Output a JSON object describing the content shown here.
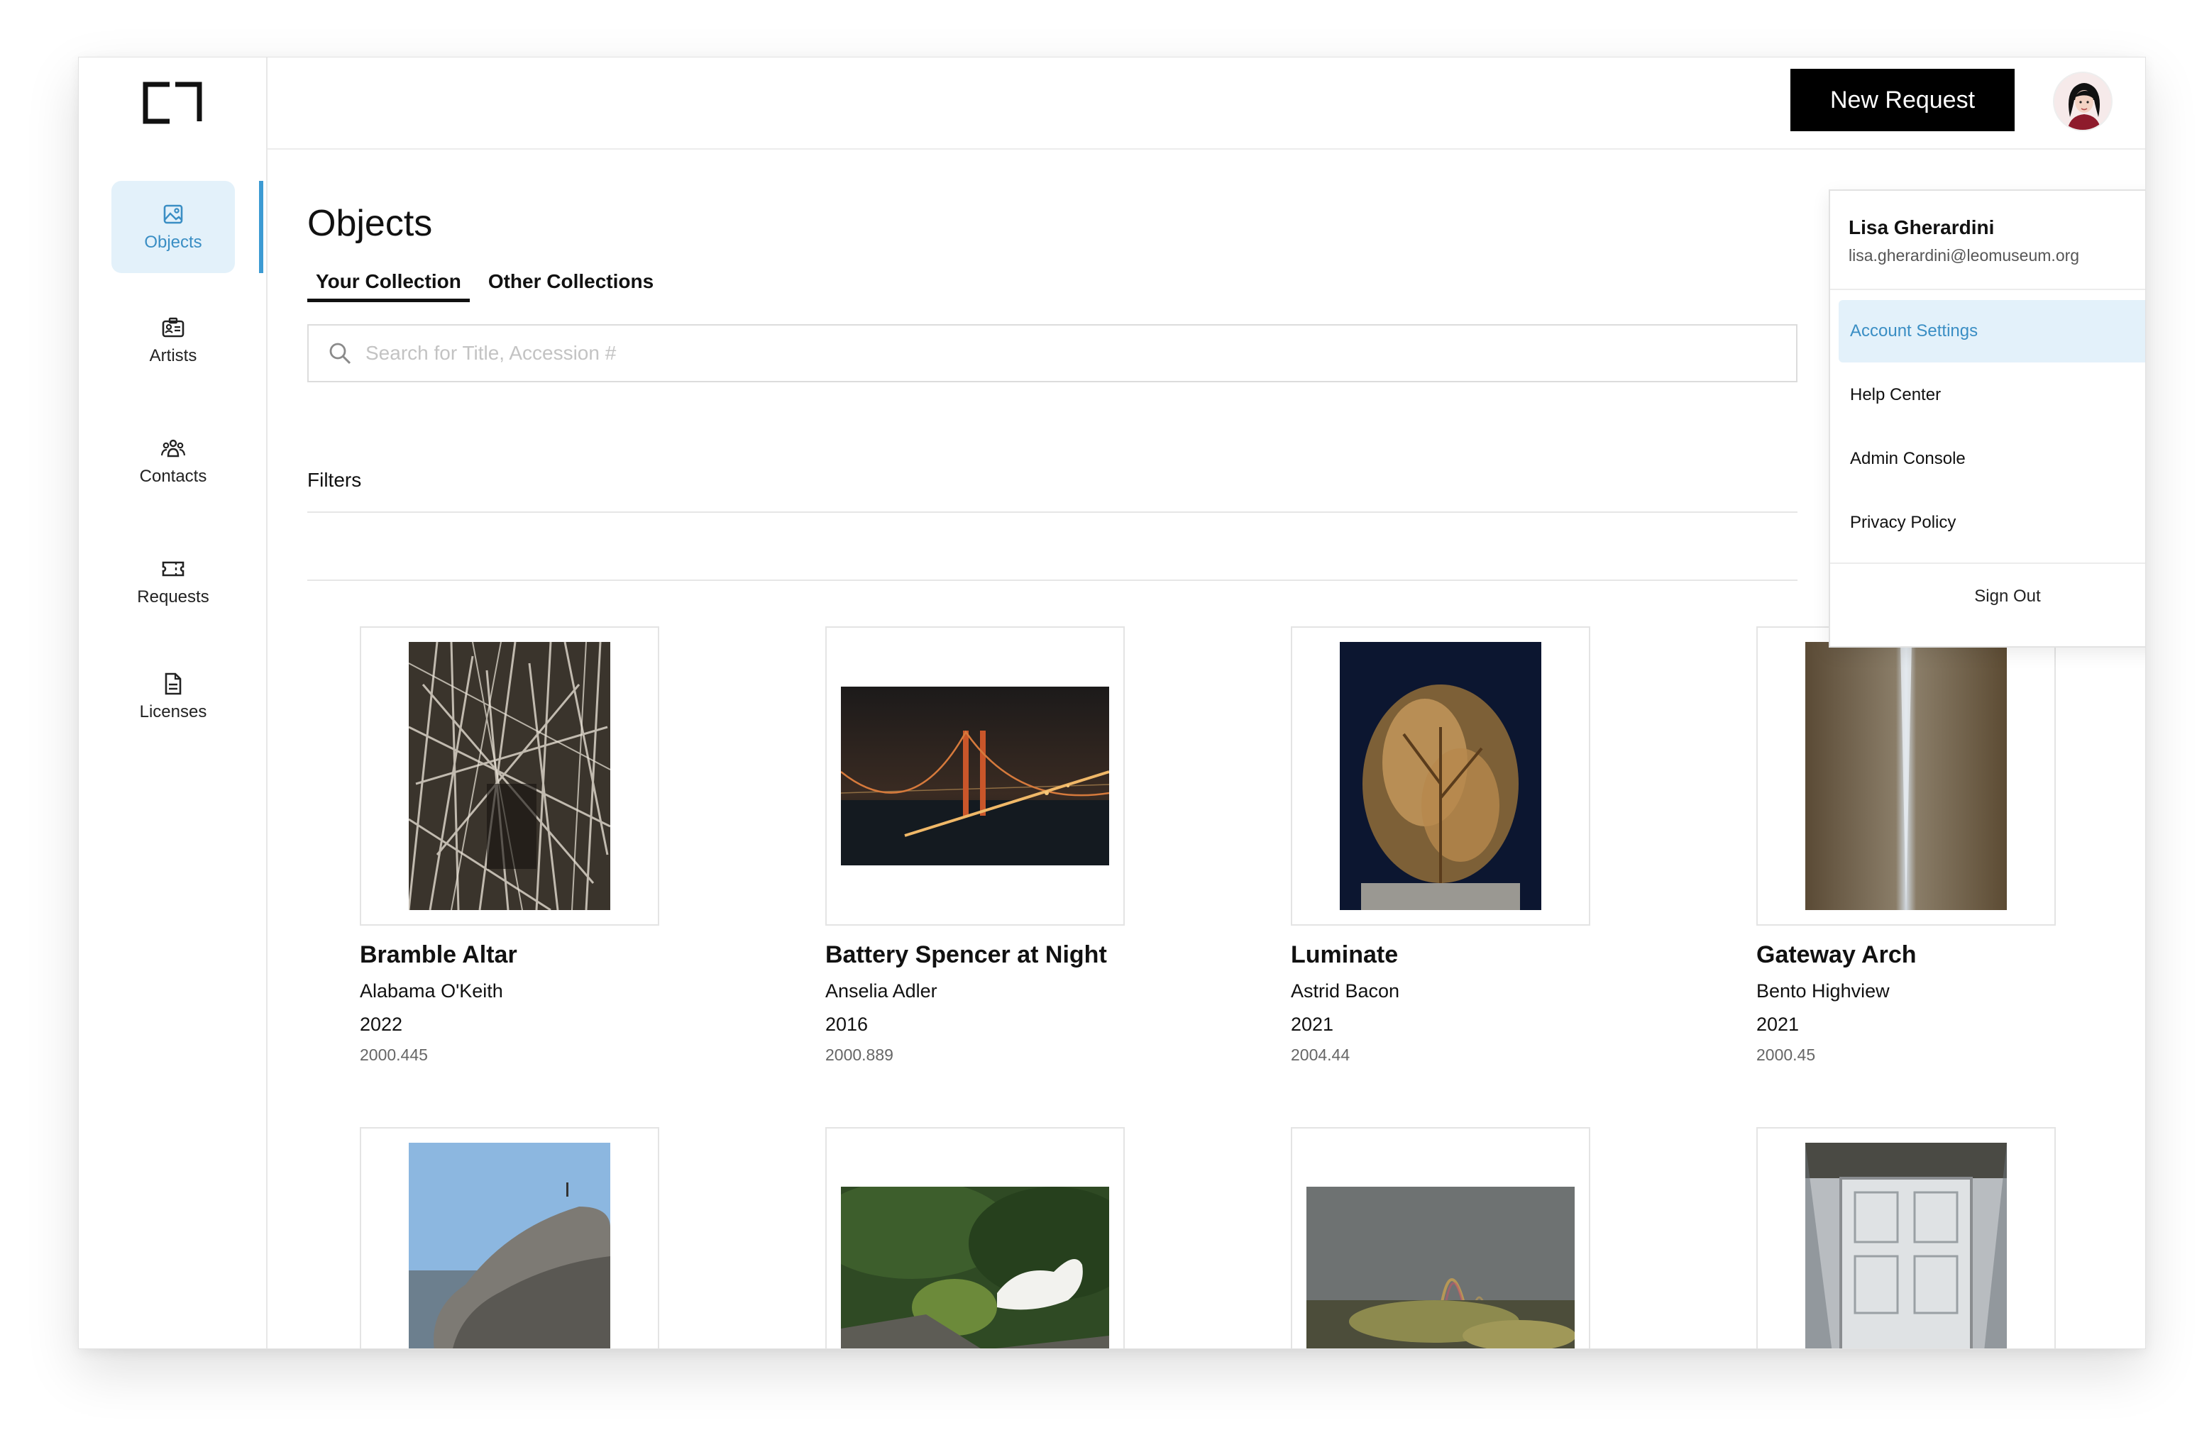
{
  "header": {
    "new_request_label": "New Request"
  },
  "sidebar": {
    "items": [
      {
        "label": "Objects",
        "icon": "image-icon"
      },
      {
        "label": "Artists",
        "icon": "id-card-icon"
      },
      {
        "label": "Contacts",
        "icon": "people-icon"
      },
      {
        "label": "Requests",
        "icon": "ticket-icon"
      },
      {
        "label": "Licenses",
        "icon": "document-icon"
      }
    ]
  },
  "main": {
    "title": "Objects",
    "tabs": [
      {
        "label": "Your Collection",
        "active": true
      },
      {
        "label": "Other Collections",
        "active": false
      }
    ],
    "search": {
      "placeholder": "Search for Title, Accession #",
      "value": ""
    },
    "filters_label": "Filters"
  },
  "objects": [
    {
      "title": "Bramble Altar",
      "artist": "Alabama O'Keith",
      "year": "2022",
      "accession": "2000.445"
    },
    {
      "title": "Battery Spencer at Night",
      "artist": "Anselia Adler",
      "year": "2016",
      "accession": "2000.889"
    },
    {
      "title": "Luminate",
      "artist": "Astrid Bacon",
      "year": "2021",
      "accession": "2004.44"
    },
    {
      "title": "Gateway Arch",
      "artist": "Bento Highview",
      "year": "2021",
      "accession": "2000.45"
    }
  ],
  "account_menu": {
    "name": "Lisa Gherardini",
    "email": "lisa.gherardini@leomuseum.org",
    "items": [
      "Account Settings",
      "Help Center",
      "Admin Console",
      "Privacy Policy"
    ],
    "sign_out": "Sign Out"
  },
  "colors": {
    "accent": "#3d9bd3",
    "active_bg": "#e3f1fa",
    "primary_button": "#000000"
  }
}
